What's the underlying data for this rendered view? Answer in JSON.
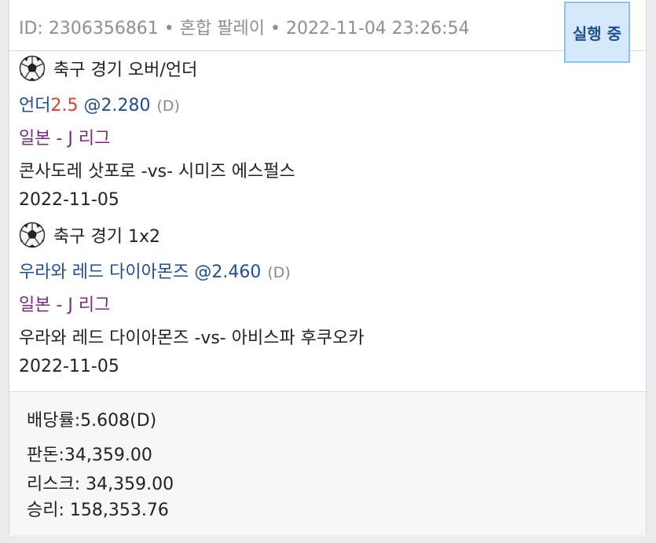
{
  "header": {
    "id_text": "ID: 2306356861",
    "sep1": " • ",
    "bet_type": "혼합 팔레이",
    "sep2": " • ",
    "datetime": "2022-11-04 23:26:54",
    "status": "실행 중"
  },
  "bets": [
    {
      "sport_icon": "soccer-ball-icon",
      "sport_market": "축구 경기 오버/언더",
      "pick_label": "언더",
      "pick_line": "2.5",
      "pick_odds": " @2.280",
      "odds_type": "(D)",
      "league": "일본 - J 리그",
      "match": "콘사도레 삿포로 -vs- 시미즈 에스펄스",
      "date": "2022-11-05"
    },
    {
      "sport_icon": "soccer-ball-icon",
      "sport_market": "축구 경기 1x2",
      "pick_label": "우라와 레드 다이아몬즈",
      "pick_line": "",
      "pick_odds": " @2.460",
      "odds_type": "(D)",
      "league": "일본 - J 리그",
      "match": "우라와 레드 다이아몬즈 -vs- 아비스파 후쿠오카",
      "date": "2022-11-05"
    }
  ],
  "summary": {
    "odds": "배당률:5.608(D)",
    "stake": "판돈:34,359.00",
    "risk": "리스크: 34,359.00",
    "win": "승리: 158,353.76"
  },
  "colors": {
    "pick": "#1f4e96",
    "line": "#e23c2f",
    "league": "#7a2a85",
    "status_bg": "#d6e8fb"
  }
}
